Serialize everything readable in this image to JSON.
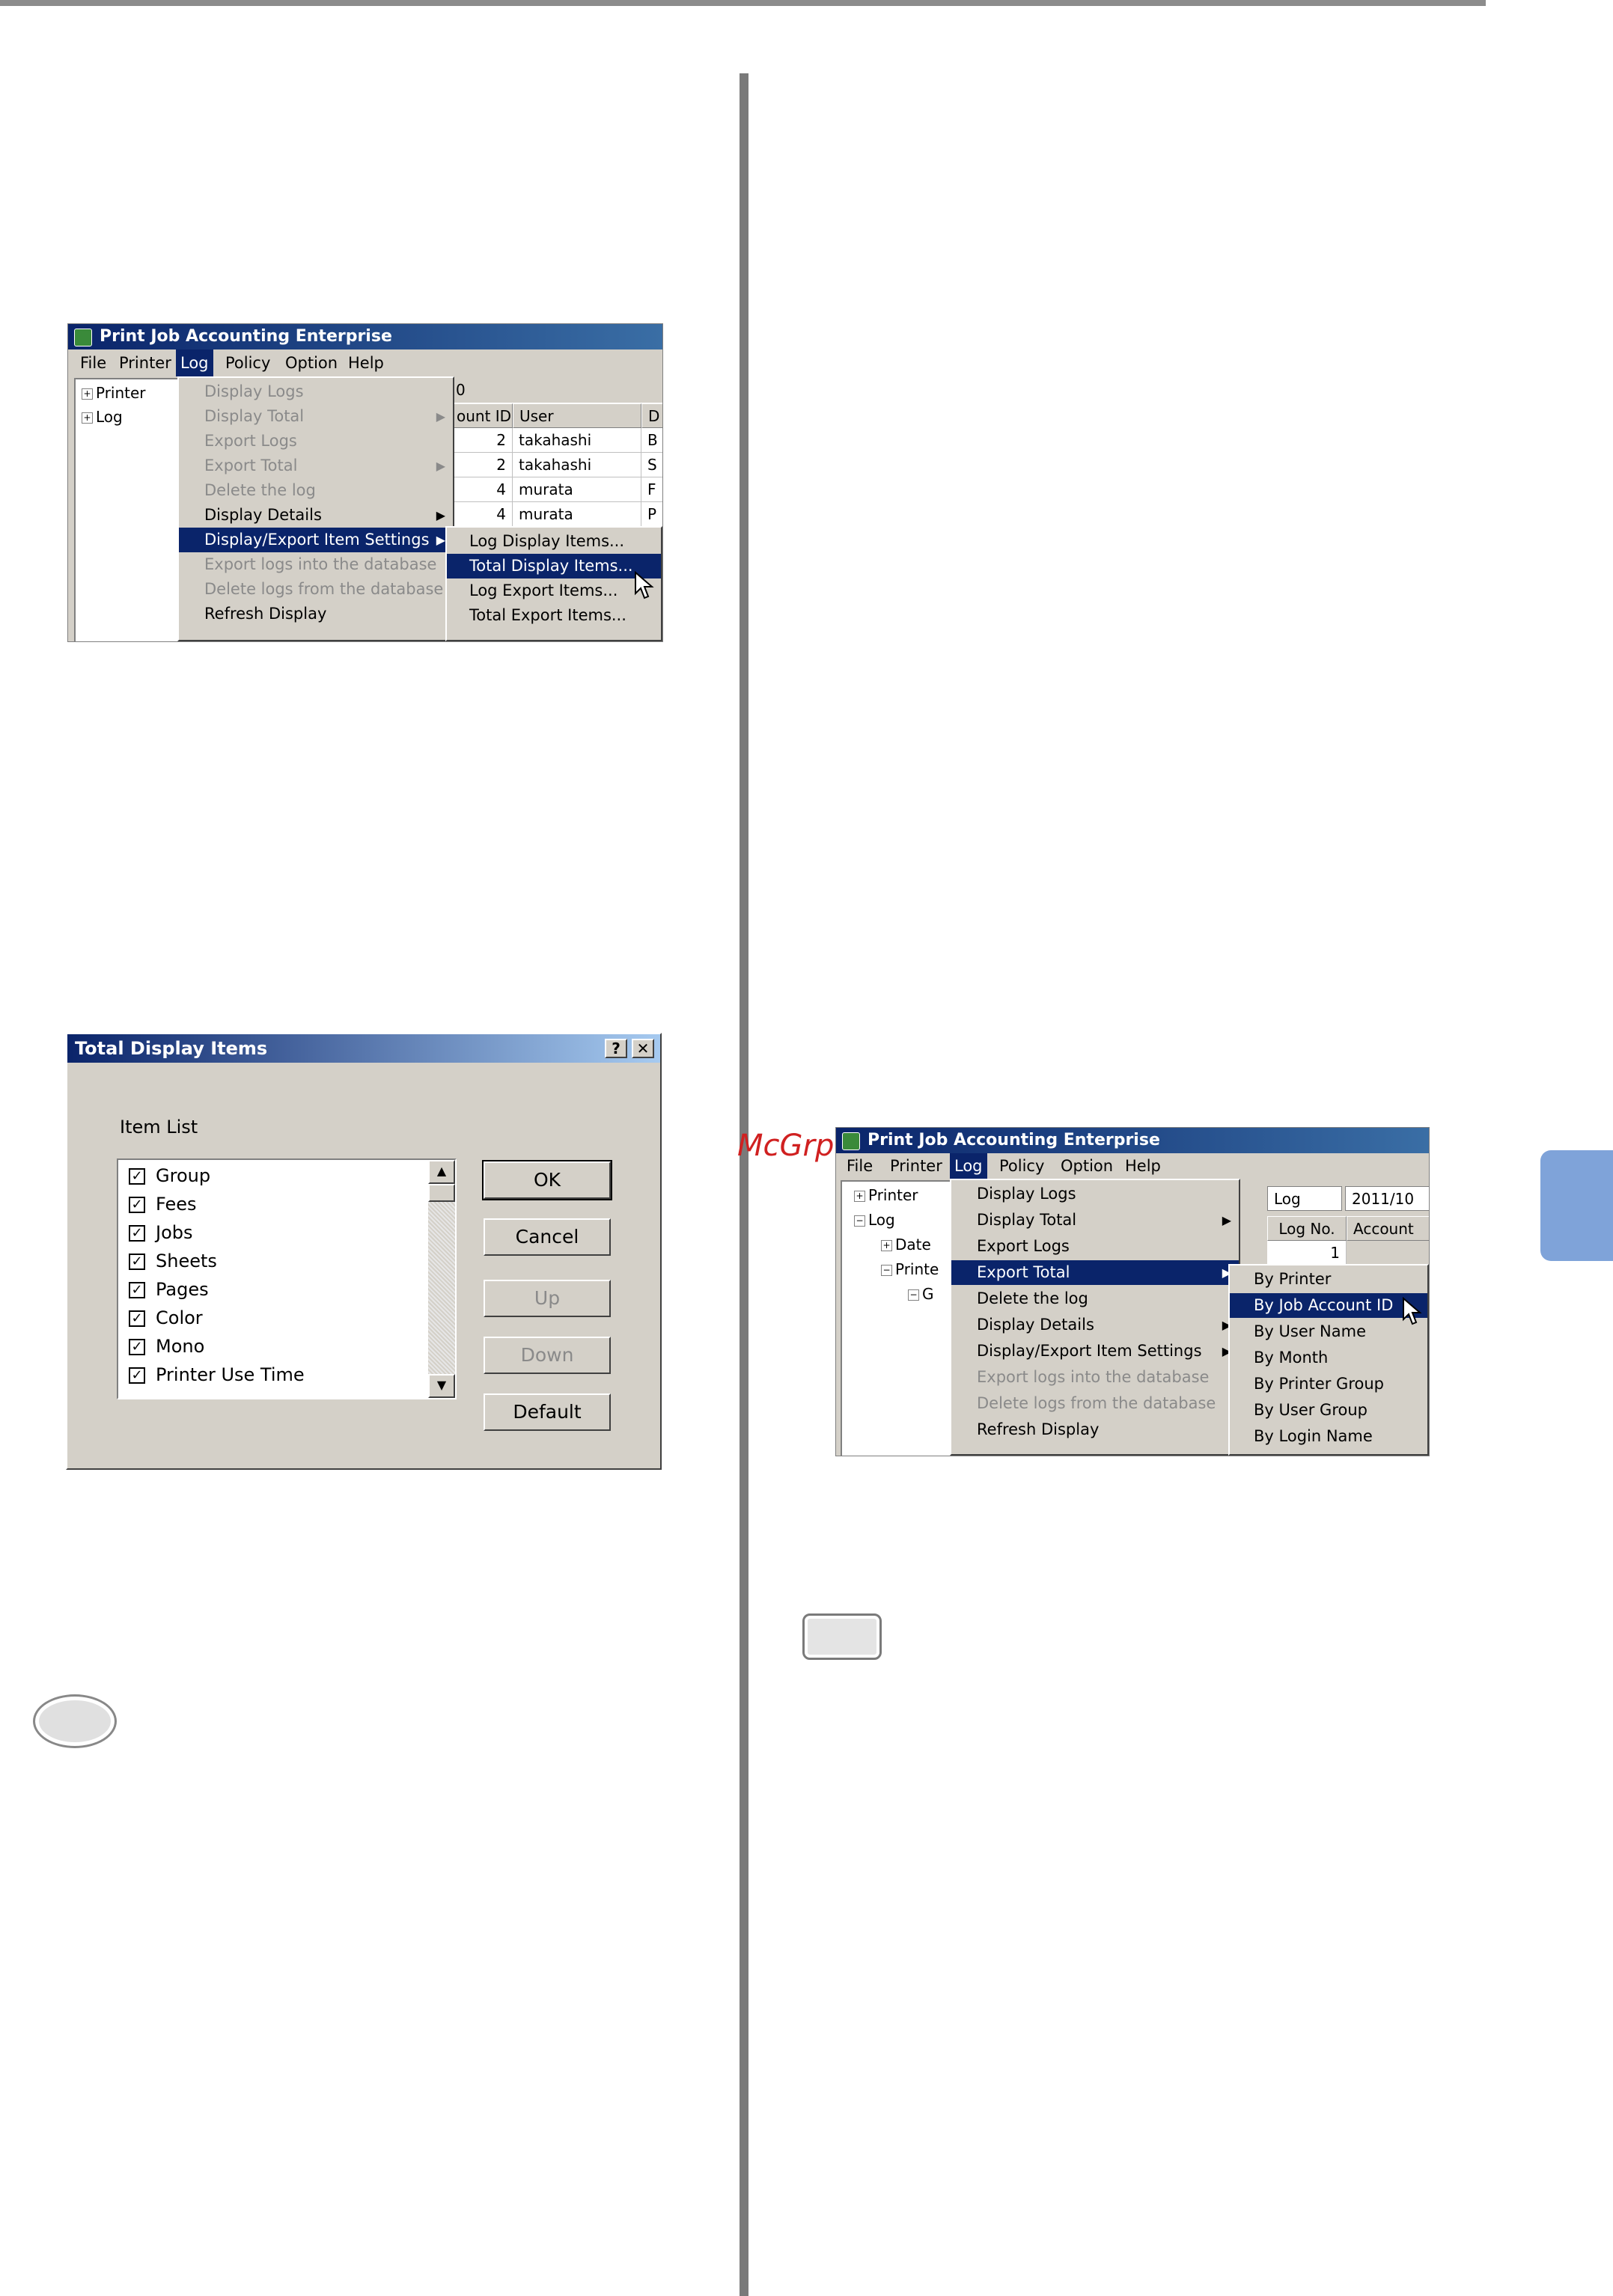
{
  "watermark": "McGrp.Ru",
  "window1": {
    "title": "Print Job Accounting Enterprise",
    "menubar": [
      "File",
      "Printer",
      "Log",
      "Policy",
      "Option",
      "Help"
    ],
    "tree": [
      "Printer",
      "Log"
    ],
    "grid": {
      "header_partial": "0",
      "columns": [
        "ount ID",
        "User",
        "D"
      ],
      "rows": [
        [
          "2",
          "takahashi",
          "B"
        ],
        [
          "2",
          "takahashi",
          "S"
        ],
        [
          "4",
          "murata",
          "F"
        ],
        [
          "4",
          "murata",
          "P"
        ]
      ]
    },
    "log_menu": [
      {
        "label": "Display Logs",
        "state": "disabled"
      },
      {
        "label": "Display Total",
        "state": "disabled",
        "submenu": true
      },
      {
        "label": "Export Logs",
        "state": "disabled"
      },
      {
        "label": "Export Total",
        "state": "disabled",
        "submenu": true
      },
      {
        "label": "Delete the log",
        "state": "disabled"
      },
      {
        "label": "Display Details",
        "state": "enabled",
        "submenu": true
      },
      {
        "label": "Display/Export Item Settings",
        "state": "highlighted",
        "submenu": true
      },
      {
        "label": "Export logs into the database",
        "state": "disabled"
      },
      {
        "label": "Delete logs from the database",
        "state": "disabled"
      },
      {
        "label": "Refresh Display",
        "state": "enabled"
      }
    ],
    "submenu": [
      {
        "label": "Log Display Items...",
        "state": "enabled"
      },
      {
        "label": "Total Display Items...",
        "state": "highlighted"
      },
      {
        "label": "Log Export Items...",
        "state": "enabled"
      },
      {
        "label": "Total Export Items...",
        "state": "enabled"
      }
    ]
  },
  "dialog": {
    "title": "Total Display Items",
    "help_btn": "?",
    "close_btn": "✕",
    "list_label": "Item List",
    "items": [
      "Group",
      "Fees",
      "Jobs",
      "Sheets",
      "Pages",
      "Color",
      "Mono",
      "Printer Use Time"
    ],
    "check_glyph": "✓",
    "buttons": {
      "ok": "OK",
      "cancel": "Cancel",
      "up": "Up",
      "down": "Down",
      "default": "Default"
    }
  },
  "window2": {
    "title": "Print Job Accounting Enterprise",
    "menubar": [
      "File",
      "Printer",
      "Log",
      "Policy",
      "Option",
      "Help"
    ],
    "tree": [
      "Printer",
      "Log",
      "Date",
      "Printe",
      "G"
    ],
    "grid": {
      "label": "Log",
      "value": "2011/10",
      "columns": [
        "Log No.",
        "Account"
      ],
      "first_row": "1"
    },
    "log_menu": [
      {
        "label": "Display Logs",
        "state": "enabled"
      },
      {
        "label": "Display Total",
        "state": "enabled",
        "submenu": true
      },
      {
        "label": "Export Logs",
        "state": "enabled"
      },
      {
        "label": "Export Total",
        "state": "highlighted",
        "submenu": true
      },
      {
        "label": "Delete the log",
        "state": "enabled"
      },
      {
        "label": "Display Details",
        "state": "enabled",
        "submenu": true
      },
      {
        "label": "Display/Export Item Settings",
        "state": "enabled",
        "submenu": true
      },
      {
        "label": "Export logs into the database",
        "state": "disabled"
      },
      {
        "label": "Delete logs from the database",
        "state": "disabled"
      },
      {
        "label": "Refresh Display",
        "state": "enabled"
      }
    ],
    "submenu": [
      {
        "label": "By Printer",
        "state": "enabled"
      },
      {
        "label": "By Job Account ID",
        "state": "highlighted"
      },
      {
        "label": "By User Name",
        "state": "enabled"
      },
      {
        "label": "By Month",
        "state": "enabled"
      },
      {
        "label": "By Printer Group",
        "state": "enabled"
      },
      {
        "label": "By User Group",
        "state": "enabled"
      },
      {
        "label": "By Login Name",
        "state": "enabled"
      }
    ]
  },
  "arrow_glyph": "▶",
  "scroll_up": "▲",
  "scroll_down": "▼",
  "tree_plus": "+",
  "tree_minus": "−"
}
